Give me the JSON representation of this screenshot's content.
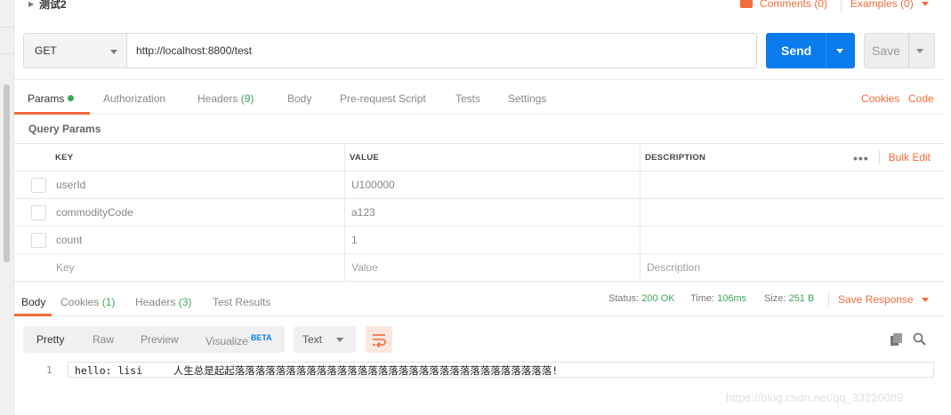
{
  "collection_name": "测试2",
  "header": {
    "comments": "Comments (0)",
    "examples": "Examples (0)"
  },
  "request": {
    "method": "GET",
    "url": "http://localhost:8800/test",
    "send_label": "Send",
    "save_label": "Save"
  },
  "request_tabs": {
    "params": "Params",
    "authorization": "Authorization",
    "headers": "Headers",
    "headers_count": "(9)",
    "body": "Body",
    "prerequest": "Pre-request Script",
    "tests": "Tests",
    "settings": "Settings",
    "cookies": "Cookies",
    "code": "Code"
  },
  "query_params": {
    "title": "Query Params",
    "columns": {
      "key": "KEY",
      "value": "VALUE",
      "description": "DESCRIPTION"
    },
    "bulk_edit": "Bulk Edit",
    "more": "•••",
    "rows": [
      {
        "key": "userId",
        "value": "U100000",
        "description": ""
      },
      {
        "key": "commodityCode",
        "value": "a123",
        "description": ""
      },
      {
        "key": "count",
        "value": "1",
        "description": ""
      }
    ],
    "placeholder": {
      "key": "Key",
      "value": "Value",
      "description": "Description"
    }
  },
  "response_tabs": {
    "body": "Body",
    "cookies": "Cookies",
    "cookies_count": "(1)",
    "headers": "Headers",
    "headers_count": "(3)",
    "test_results": "Test Results"
  },
  "response_status": {
    "status_label": "Status:",
    "status_value": "200 OK",
    "time_label": "Time:",
    "time_value": "106ms",
    "size_label": "Size:",
    "size_value": "251 B",
    "save_response": "Save Response"
  },
  "view_modes": {
    "pretty": "Pretty",
    "raw": "Raw",
    "preview": "Preview",
    "visualize": "Visualize",
    "beta": "BETA"
  },
  "format": "Text",
  "response_body": {
    "line_number": "1",
    "text": "hello: lisi     人生总是起起落落落落落落落落落落落落落落落落落落落落落落落落落落落落落落落!"
  },
  "watermark": "https://blog.csdn.net/qq_33220089",
  "colors": {
    "accent": "#f26b3a",
    "send": "#097bed",
    "success": "#3fa65b"
  }
}
